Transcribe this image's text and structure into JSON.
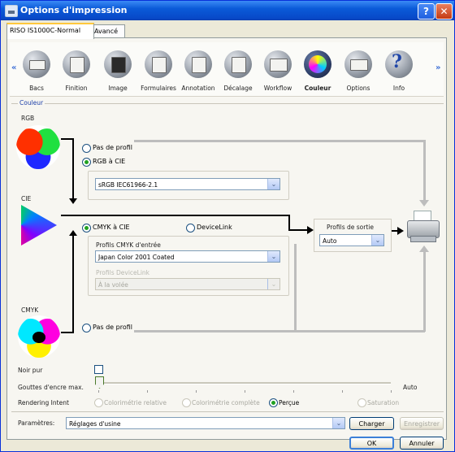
{
  "window": {
    "title": "Options d'impression",
    "help_glyph": "?",
    "close_glyph": "✕"
  },
  "tabs": [
    {
      "label": "RISO IS1000C-Normal"
    },
    {
      "label": "Avancé"
    }
  ],
  "toolbar": {
    "items": [
      {
        "label": "Bacs",
        "icon": "trays-icon"
      },
      {
        "label": "Finition",
        "icon": "finishing-icon"
      },
      {
        "label": "Image",
        "icon": "image-icon"
      },
      {
        "label": "Formulaires",
        "icon": "forms-icon"
      },
      {
        "label": "Annotation",
        "icon": "annotation-icon"
      },
      {
        "label": "Décalage",
        "icon": "offset-icon"
      },
      {
        "label": "Workflow",
        "icon": "workflow-icon"
      },
      {
        "label": "Couleur",
        "icon": "color-icon",
        "selected": true
      },
      {
        "label": "Options",
        "icon": "options-icon"
      },
      {
        "label": "Info",
        "icon": "info-icon"
      }
    ],
    "scroll_left": "«",
    "scroll_right": "»",
    "help_glyph": "?"
  },
  "couleur": {
    "section_title": "Couleur",
    "rgb_label": "RGB",
    "cie_label": "CIE",
    "cmyk_label": "CMYK",
    "rgb_no_profile": "Pas de profil",
    "rgb_to_cie": "RGB à CIE",
    "rgb_profile_value": "sRGB IEC61966-2.1",
    "cmyk_to_cie": "CMYK à CIE",
    "devicelink": "DeviceLink",
    "cmyk_input_label": "Profils CMYK d'entrée",
    "cmyk_input_value": "Japan Color 2001 Coated",
    "devicelink_profiles_label": "Profils DeviceLink",
    "devicelink_value": "À la volée",
    "cmyk_no_profile": "Pas de profil",
    "output_profiles_label": "Profils de sortie",
    "output_profiles_value": "Auto",
    "dropdown_glyph": "⌄"
  },
  "options": {
    "noir_pur_label": "Noir pur",
    "ink_drops_label": "Gouttes d'encre max.",
    "ink_drops_value_label": "Auto",
    "ink_drops_level": 0,
    "rendering_intent_label": "Rendering Intent",
    "intents": [
      {
        "label": "Colorimétrie relative",
        "selected": false,
        "enabled": false
      },
      {
        "label": "Colorimétrie complète",
        "selected": false,
        "enabled": false
      },
      {
        "label": "Perçue",
        "selected": true,
        "enabled": true
      },
      {
        "label": "Saturation",
        "selected": false,
        "enabled": false
      }
    ]
  },
  "params": {
    "label": "Paramètres:",
    "value": "Réglages d'usine",
    "load_button": "Charger",
    "save_button": "Enregistrer"
  },
  "footer": {
    "ok": "OK",
    "cancel": "Annuler"
  },
  "colors": {
    "title_bar": "#0a5ad8",
    "selected_radio": "#21a121",
    "link_blue": "#1b3ea8"
  }
}
